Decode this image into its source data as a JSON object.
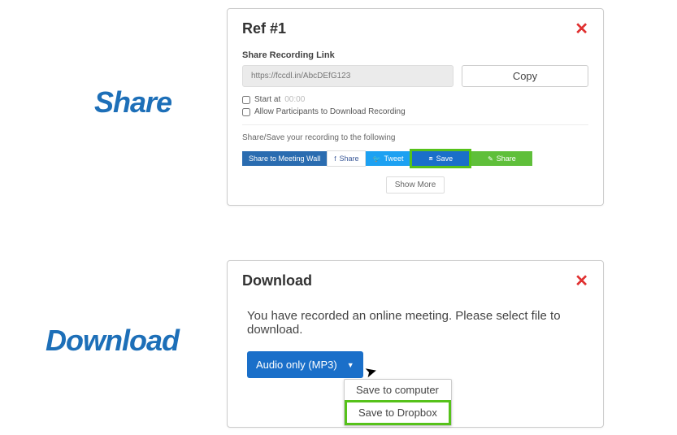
{
  "labels": {
    "share": "Share",
    "download": "Download"
  },
  "share_panel": {
    "title": "Ref #1",
    "close": "✕",
    "link_label": "Share Recording Link",
    "link_url": "https://fccdl.in/AbcDEfG123",
    "copy": "Copy",
    "start_at_label": "Start at",
    "start_at_time": "00:00",
    "allow_label": "Allow Participants to Download Recording",
    "share_hint": "Share/Save your recording to the following",
    "btn_meeting": "Share to Meeting Wall",
    "btn_fb": "Share",
    "btn_tw": "Tweet",
    "btn_save": "Save",
    "btn_ev": "Share",
    "show_more": "Show More"
  },
  "dl_panel": {
    "title": "Download",
    "close": "✕",
    "message": "You have recorded an online meeting. Please select file to download.",
    "dd_label": "Audio only (MP3)",
    "menu1": "Save to computer",
    "menu2": "Save to Dropbox"
  }
}
